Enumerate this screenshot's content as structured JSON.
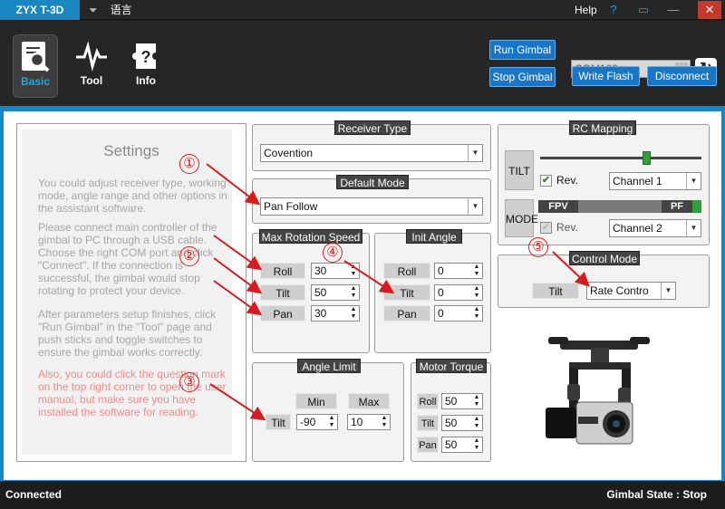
{
  "titlebar": {
    "app_title": "ZYX T-3D",
    "language_label": "语言",
    "help_label": "Help",
    "help_icon": "question-icon",
    "feedback_icon": "chat-icon",
    "close_icon": "close-icon"
  },
  "toolbar": {
    "nav": [
      {
        "label": "Basic",
        "icon": "search-document-icon"
      },
      {
        "label": "Tool",
        "icon": "waveform-icon"
      },
      {
        "label": "Info",
        "icon": "info-puzzle-icon"
      }
    ],
    "run_gimbal": "Run Gimbal",
    "stop_gimbal": "Stop Gimbal",
    "com_port": "COM109",
    "write_flash": "Write Flash",
    "disconnect": "Disconnect"
  },
  "settings": {
    "title": "Settings",
    "p1": "You could adjust receiver type, working mode, angle range and other options in the assistant software.",
    "p2": "Please connect main controller of the gimbal to PC through a USB cable. Choose the right COM port and click \"Connect\". If the connection is successful, the gimbal would stop rotating to protect your device.",
    "p3": "After parameters setup finishes, click \"Run Gimbal\" in the \"Tool\" page and push sticks and toggle switches to ensure the gimbal works correctly.",
    "p4": "Also, you could click the question mark on the top right corner to open the user manual, but make sure you have installed the software for reading."
  },
  "receiver_type": {
    "title": "Receiver Type",
    "value": "Covention"
  },
  "default_mode": {
    "title": "Default Mode",
    "value": "Pan Follow"
  },
  "max_rotation_speed": {
    "title": "Max Rotation Speed",
    "rows": [
      {
        "label": "Roll",
        "value": "30"
      },
      {
        "label": "Tilt",
        "value": "50"
      },
      {
        "label": "Pan",
        "value": "30"
      }
    ]
  },
  "init_angle": {
    "title": "Init Angle",
    "rows": [
      {
        "label": "Roll",
        "value": "0"
      },
      {
        "label": "Tilt",
        "value": "0"
      },
      {
        "label": "Pan",
        "value": "0"
      }
    ]
  },
  "angle_limit": {
    "title": "Angle Limit",
    "min_label": "Min",
    "max_label": "Max",
    "row_label": "Tilt",
    "min_value": "-90",
    "max_value": "10"
  },
  "motor_torque": {
    "title": "Motor Torque",
    "rows": [
      {
        "label": "Roll",
        "value": "50"
      },
      {
        "label": "Tilt",
        "value": "50"
      },
      {
        "label": "Pan",
        "value": "50"
      }
    ]
  },
  "rc_mapping": {
    "title": "RC Mapping",
    "tilt_label": "TILT",
    "tilt_rev_label": "Rev.",
    "tilt_rev_checked": true,
    "tilt_channel": "Channel 1",
    "tilt_slider_level": 0.66,
    "mode_label": "MODE",
    "fpv_label": "FPV",
    "pf_label": "PF",
    "mode_rev_label": "Rev.",
    "mode_rev_checked": false,
    "mode_channel": "Channel 2"
  },
  "control_mode": {
    "title": "Control Mode",
    "label": "Tilt",
    "value": "Rate Contro"
  },
  "annotations": [
    "①",
    "②",
    "③",
    "④",
    "⑤"
  ],
  "status": {
    "left": "Connected",
    "right": "Gimbal State : Stop"
  },
  "colors": {
    "accent": "#1a87c2",
    "button": "#1976c7",
    "annotation": "#d61c1c",
    "close": "#c23a2a"
  }
}
